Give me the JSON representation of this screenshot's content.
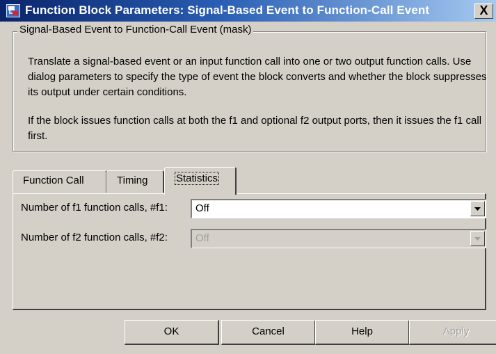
{
  "window": {
    "title": "Function Block Parameters: Signal-Based Event to Function-Call Event",
    "close_glyph": "X",
    "icon": "simulink-block-icon"
  },
  "group": {
    "legend": "Signal-Based Event to Function-Call Event (mask)",
    "description_1": "Translate a signal-based event or an input function call into one or two output function calls. Use dialog parameters to specify the type of event the block converts and whether the block suppresses its output under certain conditions.",
    "description_2": "If the block issues function calls at both the f1 and optional f2 output ports, then it issues the f1 call first."
  },
  "tabs": [
    {
      "label": "Function Call",
      "selected": false
    },
    {
      "label": "Timing",
      "selected": false
    },
    {
      "label": "Statistics",
      "selected": true
    }
  ],
  "fields": [
    {
      "label": "Number of f1 function calls, #f1:",
      "value": "Off",
      "enabled": true
    },
    {
      "label": "Number of f2 function calls, #f2:",
      "value": "Off",
      "enabled": false
    }
  ],
  "buttons": {
    "ok": "OK",
    "cancel": "Cancel",
    "help": "Help",
    "apply": "Apply"
  }
}
